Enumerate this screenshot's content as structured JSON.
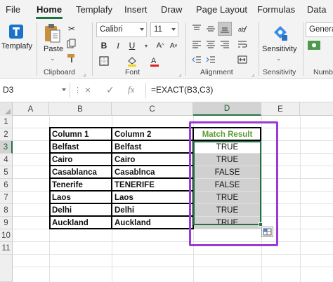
{
  "ribbon_tabs": [
    "File",
    "Home",
    "Templafy",
    "Insert",
    "Draw",
    "Page Layout",
    "Formulas",
    "Data"
  ],
  "active_tab": "Home",
  "ribbon": {
    "templafy": {
      "label": "Templafy"
    },
    "clipboard": {
      "paste_label": "Paste",
      "group_label": "Clipboard"
    },
    "font": {
      "font_name": "Calibri",
      "font_size": "11",
      "group_label": "Font"
    },
    "alignment": {
      "group_label": "Alignment"
    },
    "sensitivity": {
      "button_label": "Sensitivity",
      "group_label": "Sensitivity"
    },
    "number": {
      "format": "General",
      "group_label": "Numbe"
    }
  },
  "formula_bar": {
    "name_box": "D3",
    "cancel_icon": "×",
    "enter_icon": "✓",
    "fx_label": "fx",
    "formula": "=EXACT(B3,C3)"
  },
  "columns": [
    "A",
    "B",
    "C",
    "D",
    "E"
  ],
  "selected_column": "D",
  "rows": [
    "1",
    "2",
    "3",
    "4",
    "5",
    "6",
    "7",
    "8",
    "9",
    "10",
    "11"
  ],
  "selected_row": "3",
  "table": {
    "headers": [
      "Column 1",
      "Column 2",
      "Match Result"
    ],
    "rows": [
      [
        "Belfast",
        "Belfast",
        "TRUE"
      ],
      [
        "Cairo",
        "Cairo",
        "TRUE"
      ],
      [
        "Casablanca",
        "Casablnca",
        "FALSE"
      ],
      [
        "Tenerife",
        "TENERIFE",
        "FALSE"
      ],
      [
        "Laos",
        "Laos",
        "TRUE"
      ],
      [
        "Delhi",
        "Delhi",
        "TRUE"
      ],
      [
        "Auckland",
        "Auckland",
        "TRUE"
      ]
    ]
  },
  "colors": {
    "accent_green": "#217346",
    "match_header_green": "#5a9f33",
    "highlight_purple": "#9b3bd5",
    "result_fill": "#d0d0d0"
  }
}
